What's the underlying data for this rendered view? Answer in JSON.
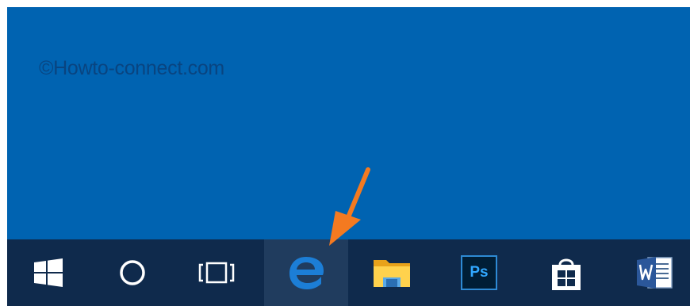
{
  "watermark": {
    "text": "©Howto-connect.com"
  },
  "taskbar": {
    "items": [
      {
        "name": "start",
        "icon": "windows-logo-icon",
        "active": false
      },
      {
        "name": "cortana",
        "icon": "cortana-circle-icon",
        "active": false
      },
      {
        "name": "task-view",
        "icon": "task-view-icon",
        "active": false
      },
      {
        "name": "edge",
        "icon": "edge-icon",
        "active": true
      },
      {
        "name": "file-explorer",
        "icon": "folder-icon",
        "active": false
      },
      {
        "name": "photoshop",
        "icon": "photoshop-icon",
        "label": "Ps",
        "active": false
      },
      {
        "name": "store",
        "icon": "store-bag-icon",
        "active": false
      },
      {
        "name": "word",
        "icon": "word-icon",
        "active": false
      }
    ]
  },
  "annotation": {
    "icon": "orange-arrow-icon",
    "color": "#f47a20",
    "points_to": "edge"
  },
  "colors": {
    "desktop": "#0063b1",
    "taskbar": "#0f2a4c",
    "active_button": "#203c5e",
    "edge_blue": "#1c7ed6"
  }
}
